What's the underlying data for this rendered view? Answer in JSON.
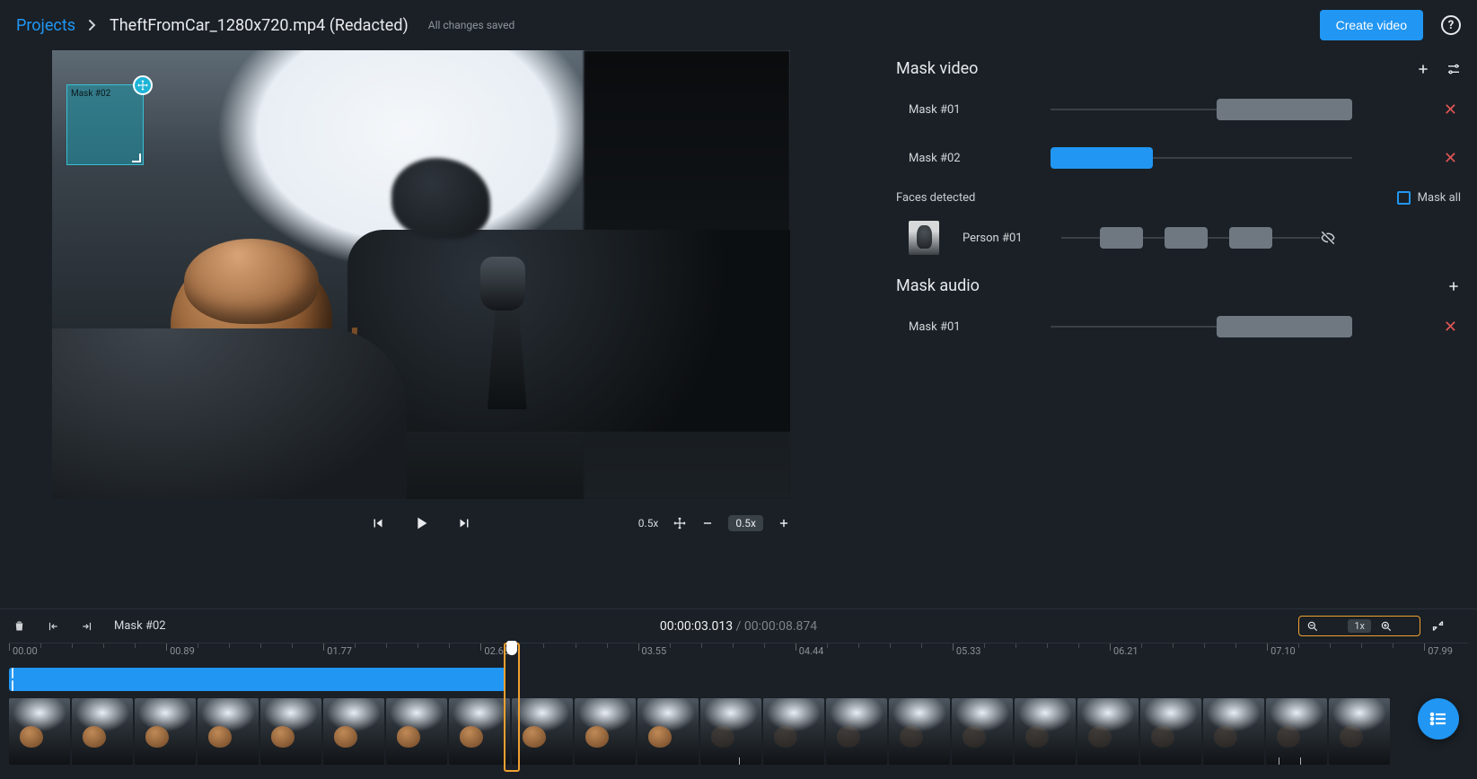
{
  "header": {
    "projects_label": "Projects",
    "filename": "TheftFromCar_1280x720.mp4 (Redacted)",
    "save_status": "All changes saved",
    "create_button": "Create video"
  },
  "preview": {
    "mask_overlay_label": "Mask #02",
    "speed_label": "0.5x",
    "zoom_badge": "0.5x"
  },
  "side": {
    "mask_video_title": "Mask video",
    "mask_audio_title": "Mask audio",
    "faces_detected_label": "Faces detected",
    "mask_all_label": "Mask all",
    "video_masks": [
      {
        "name": "Mask #01",
        "segments": [
          {
            "start_pct": 55,
            "width_pct": 45,
            "style": "gray"
          }
        ]
      },
      {
        "name": "Mask #02",
        "segments": [
          {
            "start_pct": 0,
            "width_pct": 34,
            "style": "blue"
          }
        ]
      }
    ],
    "persons": [
      {
        "name": "Person #01",
        "seg_positions_pct": [
          15,
          40,
          65
        ]
      }
    ],
    "audio_masks": [
      {
        "name": "Mask #01",
        "segments": [
          {
            "start_pct": 55,
            "width_pct": 45,
            "style": "gray"
          }
        ]
      }
    ]
  },
  "timeline": {
    "selection_name": "Mask #02",
    "current_time": "00:00:03.013",
    "duration": "00:00:08.874",
    "zoom_value": "1x",
    "ticks": [
      "00.00",
      "00.89",
      "01.77",
      "02.66",
      "03.55",
      "04.44",
      "05.33",
      "06.21",
      "07.10",
      "07.99"
    ],
    "clip": {
      "left_pct": 0,
      "width_pct": 34
    },
    "playhead_pct": 34,
    "thumb_count": 22,
    "marker_positions_pct": [
      50,
      87,
      88.5
    ]
  }
}
